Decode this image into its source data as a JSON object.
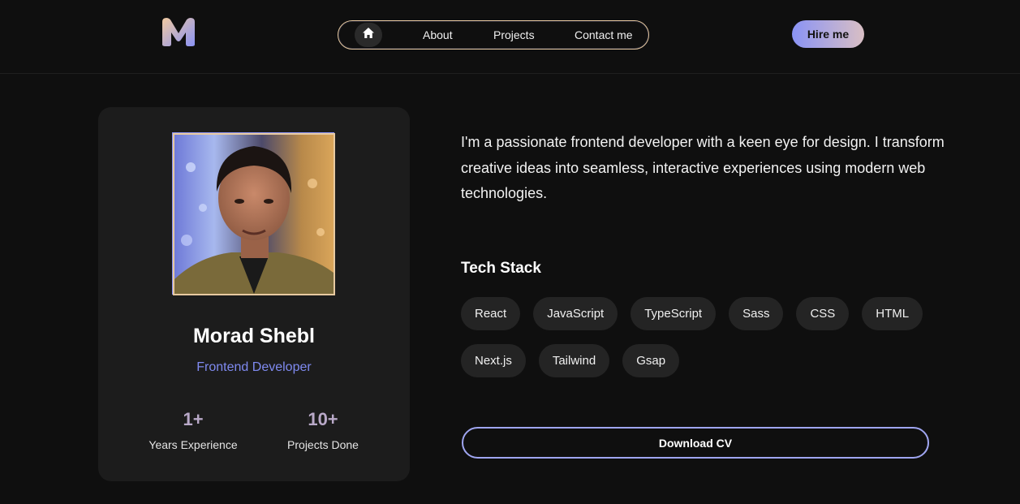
{
  "colors": {
    "background": "#0f0f0f",
    "card": "#1c1c1c",
    "accent_blue": "#7f8af0",
    "accent_peach": "#e7c9a0",
    "tag_bg": "#242424"
  },
  "header": {
    "logo_icon": "m-logo-icon",
    "nav": {
      "home_icon": "home-icon",
      "links": [
        {
          "label": "About"
        },
        {
          "label": "Projects"
        },
        {
          "label": "Contact me"
        }
      ]
    },
    "hire_label": "Hire me"
  },
  "profile": {
    "name": "Morad Shebl",
    "role": "Frontend Developer",
    "stats": [
      {
        "value": "1+",
        "label": "Years Experience"
      },
      {
        "value": "10+",
        "label": "Projects Done"
      }
    ]
  },
  "about": {
    "bio": "I'm a passionate frontend developer with a keen eye for design. I transform creative ideas into seamless, interactive experiences using modern web technologies."
  },
  "tech_stack": {
    "title": "Tech Stack",
    "items": [
      "React",
      "JavaScript",
      "TypeScript",
      "Sass",
      "CSS",
      "HTML",
      "Next.js",
      "Tailwind",
      "Gsap"
    ]
  },
  "cta": {
    "download_label": "Download CV"
  }
}
